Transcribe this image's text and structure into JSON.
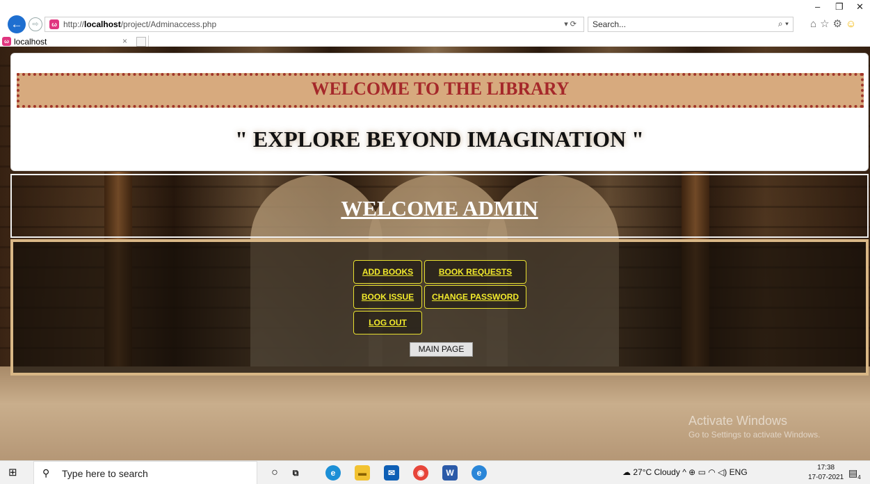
{
  "browser": {
    "url_prefix": "http://",
    "url_host": "localhost",
    "url_path": "/project/Adminaccess.php",
    "addr_tools": "▾ ⟳",
    "search_placeholder": "Search...",
    "tab_title": "localhost",
    "tab_close": "×",
    "window_minimize": "–",
    "window_restore": "❐",
    "window_close": "✕",
    "icons": [
      "home-icon",
      "star-icon",
      "gear-icon",
      "smiley-icon"
    ]
  },
  "page": {
    "banner": "WELCOME TO THE LIBRARY",
    "tagline": "\" EXPLORE BEYOND IMAGINATION \"",
    "admin_title": "WELCOME ADMIN",
    "buttons": {
      "add_books": "ADD BOOKS",
      "book_requests": "BOOK REQUESTS",
      "book_issue": "BOOK ISSUE",
      "change_password": "CHANGE PASSWORD",
      "log_out": "LOG OUT",
      "main_page": "MAIN PAGE"
    },
    "button_color": "#f2ea2c",
    "banner_color": "#d7aa7e"
  },
  "watermark": {
    "line1": "Activate Windows",
    "line2": "Go to Settings to activate Windows."
  },
  "taskbar": {
    "search_placeholder": "Type here to search",
    "weather": "27°C Cloudy",
    "language": "ENG",
    "time": "17:38",
    "date": "17-07-2021",
    "notification_count": "4"
  }
}
